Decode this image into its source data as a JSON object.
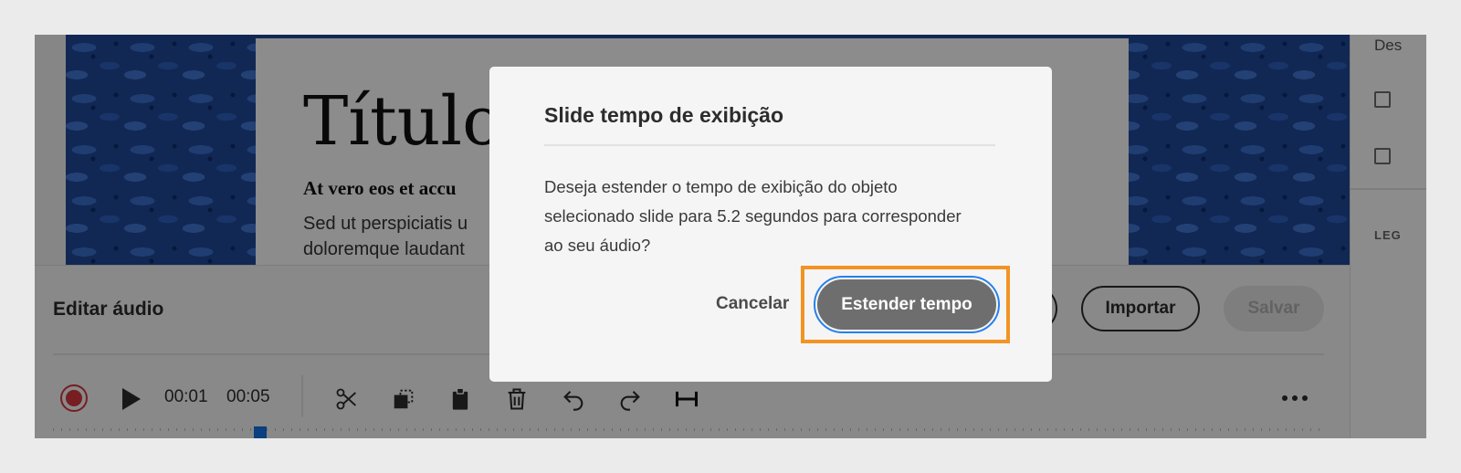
{
  "slide": {
    "title": "Título",
    "subtitle": "At vero eos et accu",
    "body_lines": [
      "Sed ut perspiciatis u",
      "doloremque laudant"
    ]
  },
  "right_panel": {
    "top_label": "Des",
    "section_label": "LEG"
  },
  "audio_editor": {
    "title": "Editar áudio",
    "importar_label": "Importar",
    "salvar_label": "Salvar",
    "current_time": "00:01",
    "duration": "00:05"
  },
  "dialog": {
    "title": "Slide tempo de exibição",
    "message_lines": [
      "Deseja estender o tempo de exibição do objeto",
      "selecionado slide para 5.2 segundos para corresponder",
      "ao seu áudio?"
    ],
    "cancel_label": "Cancelar",
    "confirm_label": "Estender tempo"
  },
  "colors": {
    "highlight": "#f29423",
    "focus_ring": "#2680eb",
    "record": "#d7373f",
    "playhead": "#1473e6"
  },
  "icons": [
    "record-icon",
    "play-icon",
    "scissors-icon",
    "crop-icon",
    "paste-icon",
    "trash-icon",
    "undo-icon",
    "redo-icon",
    "fit-width-icon",
    "more-icon"
  ]
}
